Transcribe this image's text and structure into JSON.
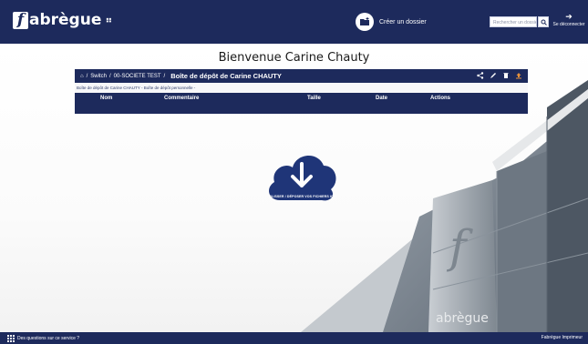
{
  "app": {
    "logo_text": "abrègue",
    "logo_letter": "f"
  },
  "header": {
    "create_label": "Créer un dossier",
    "search_placeholder": "Rechercher un dossier",
    "logout_label": "Se déconnecter"
  },
  "main": {
    "welcome": "Bienvenue Carine Chauty",
    "breadcrumb": {
      "level1": "Switch",
      "level2": "00-SOCIETE TEST",
      "current": "Boîte de dépôt de Carine CHAUTY"
    },
    "subline": "Boîte de dépôt de Carine CHAUTY - Boîte de dépôt personnelle -",
    "columns": [
      "Nom",
      "Commentaire",
      "Taille",
      "Date",
      "Actions"
    ],
    "upload_label": "GLISSER / DÉPOSER VOS FICHIERS ICI"
  },
  "footer": {
    "help_label": "Des questions sur ce service ?",
    "brand": "Fabrègue Imprimeur"
  },
  "colors": {
    "navy": "#1d2a5c",
    "upload_cloud": "#1f3578",
    "accent": "#e8913a"
  },
  "icons": [
    "home-icon",
    "share-icon",
    "edit-icon",
    "trash-icon",
    "upload-icon",
    "search-icon",
    "logout-icon",
    "grid-icon",
    "cloud-download-icon"
  ]
}
